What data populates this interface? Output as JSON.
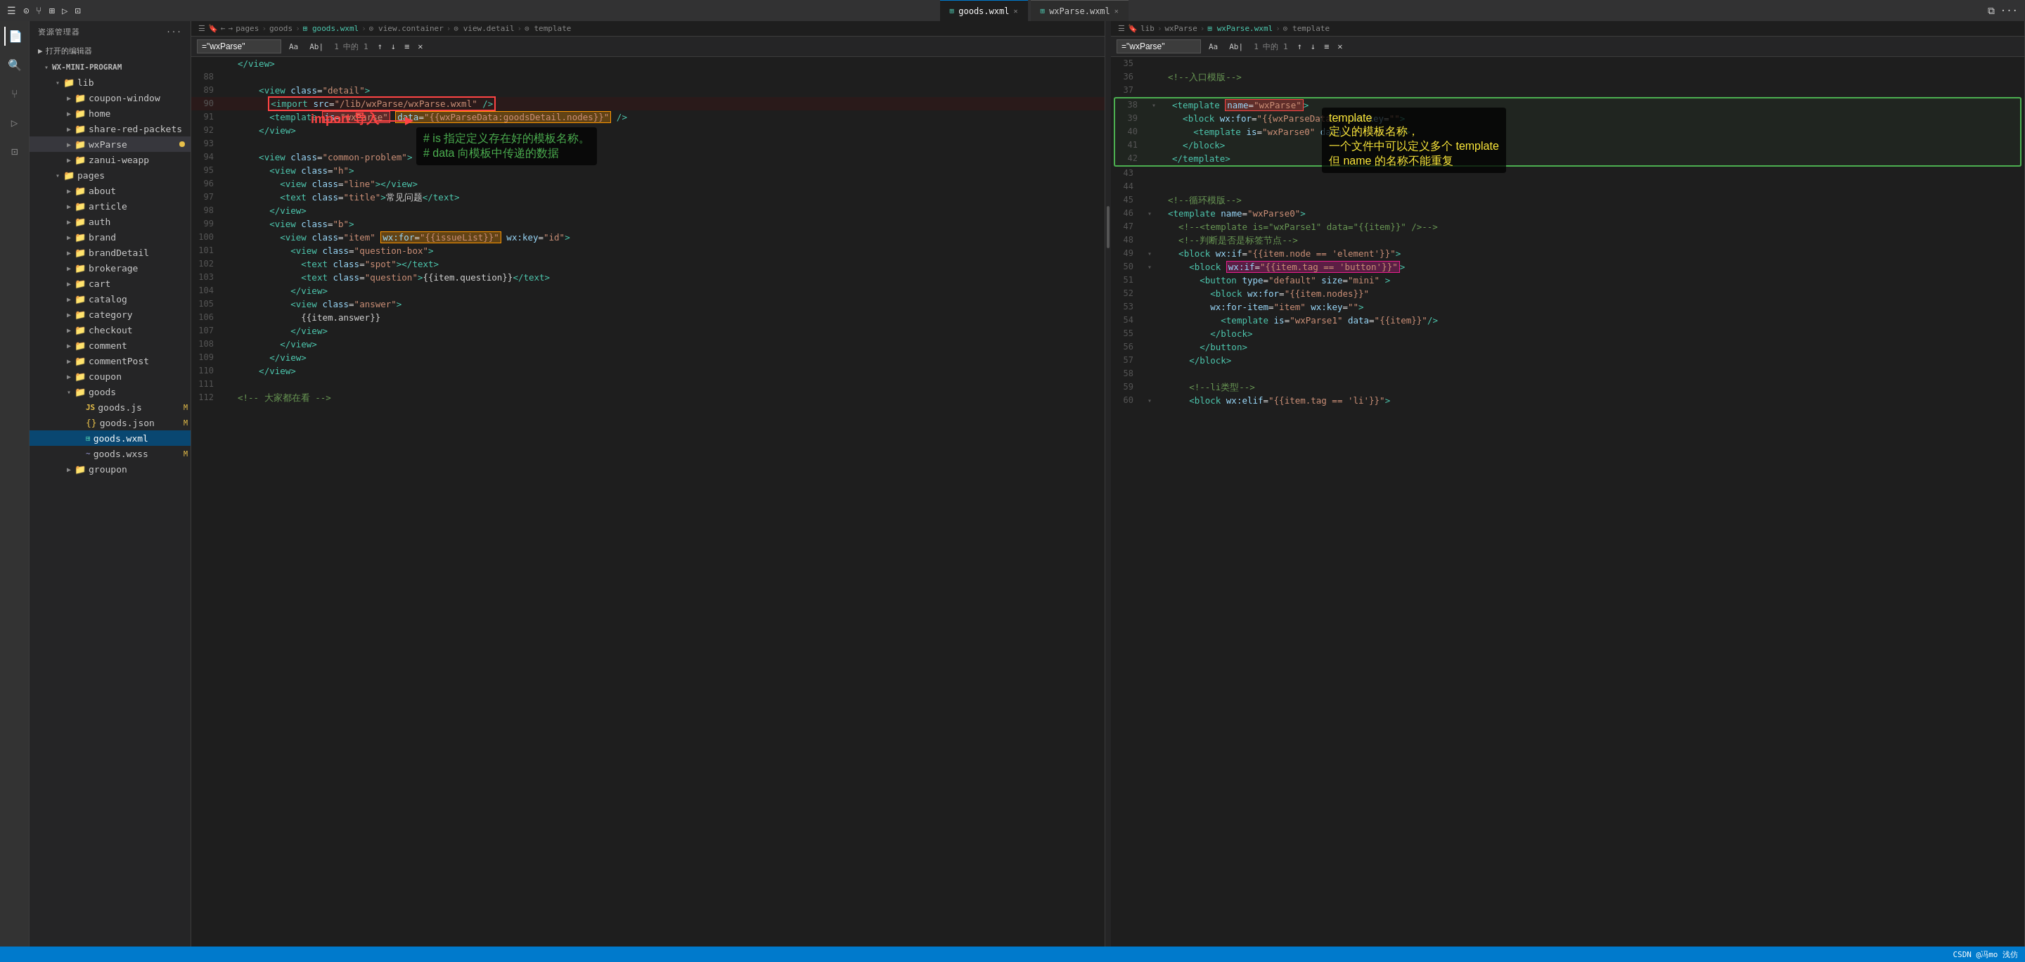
{
  "titleBar": {
    "tabs": [
      {
        "label": "goods.wxml",
        "active": true,
        "icon": "wxml"
      },
      {
        "label": "wxParse.wxml",
        "active": false,
        "icon": "wxml"
      }
    ],
    "rightMenuLabel": "..."
  },
  "sidebar": {
    "title": "资源管理器",
    "openEditors": "打开的编辑器",
    "projectName": "WX-MINI-PROGRAM",
    "tree": [
      {
        "id": "lib",
        "label": "lib",
        "type": "folder",
        "indent": 1,
        "expanded": true
      },
      {
        "id": "coupon-window",
        "label": "coupon-window",
        "type": "folder",
        "indent": 2
      },
      {
        "id": "home",
        "label": "home",
        "type": "folder",
        "indent": 2
      },
      {
        "id": "share-red-packets",
        "label": "share-red-packets",
        "type": "folder",
        "indent": 2
      },
      {
        "id": "wxParse",
        "label": "wxParse",
        "type": "folder",
        "indent": 2,
        "badge": true,
        "highlighted": true
      },
      {
        "id": "zanui-weapp",
        "label": "zanui-weapp",
        "type": "folder",
        "indent": 2
      },
      {
        "id": "pages",
        "label": "pages",
        "type": "folder",
        "indent": 1,
        "expanded": true
      },
      {
        "id": "about",
        "label": "about",
        "type": "folder",
        "indent": 2
      },
      {
        "id": "article",
        "label": "article",
        "type": "folder",
        "indent": 2
      },
      {
        "id": "auth",
        "label": "auth",
        "type": "folder",
        "indent": 2
      },
      {
        "id": "brand",
        "label": "brand",
        "type": "folder",
        "indent": 2
      },
      {
        "id": "brandDetail",
        "label": "brandDetail",
        "type": "folder",
        "indent": 2
      },
      {
        "id": "brokerage",
        "label": "brokerage",
        "type": "folder",
        "indent": 2
      },
      {
        "id": "cart",
        "label": "cart",
        "type": "folder",
        "indent": 2
      },
      {
        "id": "catalog",
        "label": "catalog",
        "type": "folder",
        "indent": 2
      },
      {
        "id": "category",
        "label": "category",
        "type": "folder",
        "indent": 2
      },
      {
        "id": "checkout",
        "label": "checkout",
        "type": "folder",
        "indent": 2
      },
      {
        "id": "comment",
        "label": "comment",
        "type": "folder",
        "indent": 2
      },
      {
        "id": "commentPost",
        "label": "commentPost",
        "type": "folder",
        "indent": 2
      },
      {
        "id": "coupon",
        "label": "coupon",
        "type": "folder",
        "indent": 2
      },
      {
        "id": "goods",
        "label": "goods",
        "type": "folder",
        "indent": 2,
        "expanded": true
      },
      {
        "id": "goods-js",
        "label": "goods.js",
        "type": "file-js",
        "indent": 3,
        "badge": "M"
      },
      {
        "id": "goods-json",
        "label": "goods.json",
        "type": "file-json",
        "indent": 3,
        "badge": "M"
      },
      {
        "id": "goods-wxml",
        "label": "goods.wxml",
        "type": "file-wxml",
        "indent": 3,
        "active": true
      },
      {
        "id": "goods-wxss",
        "label": "goods.wxss",
        "type": "file-wxss",
        "indent": 3,
        "badge": "M"
      },
      {
        "id": "groupon",
        "label": "groupon",
        "type": "folder",
        "indent": 2
      }
    ]
  },
  "editor1": {
    "filename": "goods.wxml",
    "breadcrumb": [
      "pages",
      ">",
      "goods",
      ">",
      "goods.wxml",
      ">",
      "view.container",
      ">",
      "view.detail",
      ">",
      "template"
    ],
    "findText": "=\"wxParse\"",
    "findCount": "1 中的 1",
    "lines": [
      {
        "num": "",
        "fold": "",
        "code": "</view>"
      },
      {
        "num": "88",
        "fold": "",
        "code": ""
      },
      {
        "num": "89",
        "fold": "",
        "code": "    <view class=\"detail\">"
      },
      {
        "num": "90",
        "fold": "",
        "code": "      <import src=\"/lib/wxParse/wxParse.wxml\" />",
        "highlight": "import-red"
      },
      {
        "num": "91",
        "fold": "",
        "code": "      <template is=\"wxParse\" data=\"{{wxParseData:goodsDetail.nodes}}\" />",
        "highlight": "template-line"
      },
      {
        "num": "92",
        "fold": "",
        "code": "    </view>"
      },
      {
        "num": "93",
        "fold": "",
        "code": ""
      },
      {
        "num": "94",
        "fold": "",
        "code": "    <view class=\"common-problem\">"
      },
      {
        "num": "95",
        "fold": "",
        "code": "      <view class=\"h\">"
      },
      {
        "num": "96",
        "fold": "",
        "code": "        <view class=\"line\"></view>"
      },
      {
        "num": "97",
        "fold": "",
        "code": "        <text class=\"title\">常见问题</text>"
      },
      {
        "num": "98",
        "fold": "",
        "code": "      </view>"
      },
      {
        "num": "99",
        "fold": "",
        "code": "      <view class=\"b\">"
      },
      {
        "num": "100",
        "fold": "",
        "code": "        <view class=\"item\" wx:for=\"{{issueList}}\" wx:key=\"id\">",
        "highlight": "wxfor-orange"
      },
      {
        "num": "101",
        "fold": "",
        "code": "          <view class=\"question-box\">"
      },
      {
        "num": "102",
        "fold": "",
        "code": "            <text class=\"spot\"></text>"
      },
      {
        "num": "103",
        "fold": "",
        "code": "            <text class=\"question\">{{item.question}}</text>"
      },
      {
        "num": "104",
        "fold": "",
        "code": "          </view>"
      },
      {
        "num": "105",
        "fold": "",
        "code": "          <view class=\"answer\">"
      },
      {
        "num": "106",
        "fold": "",
        "code": "            {{item.answer}}"
      },
      {
        "num": "107",
        "fold": "",
        "code": "          </view>"
      },
      {
        "num": "108",
        "fold": "",
        "code": "        </view>"
      },
      {
        "num": "109",
        "fold": "",
        "code": "      </view>"
      },
      {
        "num": "110",
        "fold": "",
        "code": "    </view>"
      },
      {
        "num": "111",
        "fold": "",
        "code": ""
      },
      {
        "num": "112",
        "fold": "",
        "code": "    <!-- 大家都在看 -->"
      }
    ]
  },
  "editor2": {
    "filename": "wxParse.wxml",
    "breadcrumb": [
      "lib",
      ">",
      "wxParse",
      ">",
      "wxParse.wxml",
      ">",
      "template"
    ],
    "findText": "=\"wxParse\"",
    "findCount": "1 中的 1",
    "lines": [
      {
        "num": "35",
        "fold": "",
        "code": ""
      },
      {
        "num": "36",
        "fold": "",
        "code": "  <!--入口模版-->"
      },
      {
        "num": "37",
        "fold": "",
        "code": ""
      },
      {
        "num": "38",
        "fold": "",
        "code": "  <template name=\"wxParse\">",
        "highlight": "template-green"
      },
      {
        "num": "39",
        "fold": "",
        "code": "    <block wx:for=\"{{wxParseData}}\" wx:key=\"\">"
      },
      {
        "num": "40",
        "fold": "",
        "code": "      <template is=\"wxParse0\" data=\"{{item}}\"/>"
      },
      {
        "num": "41",
        "fold": "",
        "code": "    </block>"
      },
      {
        "num": "42",
        "fold": "",
        "code": "  </template>",
        "blockEnd": true
      },
      {
        "num": "43",
        "fold": "",
        "code": ""
      },
      {
        "num": "44",
        "fold": "",
        "code": ""
      },
      {
        "num": "45",
        "fold": "",
        "code": "  <!--循环模版-->"
      },
      {
        "num": "46",
        "fold": "",
        "code": "  <template name=\"wxParse0\">"
      },
      {
        "num": "47",
        "fold": "",
        "code": "    <!--<template is=\"wxParse1\" data=\"{{item}}\" />-->"
      },
      {
        "num": "48",
        "fold": "",
        "code": "    <!--判断是否是标签节点-->"
      },
      {
        "num": "49",
        "fold": "",
        "code": "    <block wx:if=\"{{item.node == 'element'}}\">"
      },
      {
        "num": "50",
        "fold": "",
        "code": "      <block wx:if=\"{{item.tag == 'button'}}\">",
        "highlight": "wxif-pink"
      },
      {
        "num": "51",
        "fold": "",
        "code": "        <button type=\"default\" size=\"mini\" >"
      },
      {
        "num": "52",
        "fold": "",
        "code": "          <block wx:for=\"{{item.nodes}}\""
      },
      {
        "num": "53",
        "fold": "",
        "code": "          wx:for-item=\"item\" wx:key=\"\">"
      },
      {
        "num": "54",
        "fold": "",
        "code": "            <template is=\"wxParse1\" data=\"{{item}}\"/>"
      },
      {
        "num": "55",
        "fold": "",
        "code": "          </block>"
      },
      {
        "num": "56",
        "fold": "",
        "code": "        </button>"
      },
      {
        "num": "57",
        "fold": "",
        "code": "      </block>"
      },
      {
        "num": "58",
        "fold": "",
        "code": ""
      },
      {
        "num": "59",
        "fold": "",
        "code": "      <!--li类型-->"
      },
      {
        "num": "60",
        "fold": "",
        "code": "      <block wx:elif=\"{{item.tag == 'li'}}\">"
      }
    ]
  },
  "annotations": {
    "importLabel": "import 导入",
    "isLabel": "# is 指定定义存在好的模板名称。",
    "dataLabel": "# data 向模板中传递的数据",
    "templateDefLabel": "template",
    "templateDefLabel2": "定义的模板名称，",
    "templateDefLabel3": "一个文件中可以定义多个 template",
    "templateDefLabel4": "但 name 的名称不能重复"
  },
  "statusBar": {
    "text": "CSDN @冯mo 浅仿"
  }
}
